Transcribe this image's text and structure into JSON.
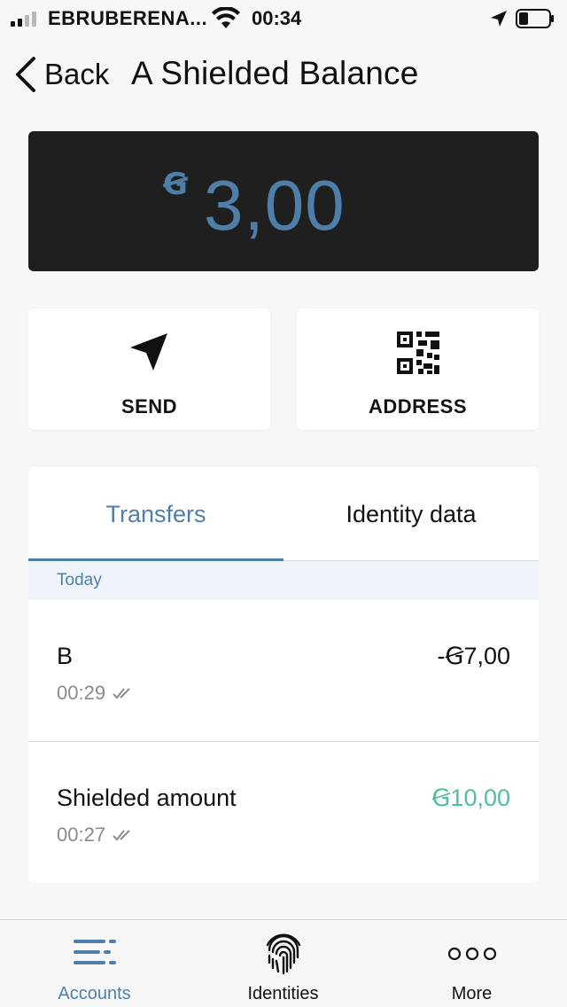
{
  "status_bar": {
    "carrier": "EBRUBERENA...",
    "time": "00:34"
  },
  "header": {
    "back_label": "Back",
    "title": "A Shielded Balance"
  },
  "balance": {
    "currency_symbol": "Ꞡ",
    "amount": "3,00"
  },
  "actions": {
    "send_label": "SEND",
    "address_label": "ADDRESS"
  },
  "tabs": {
    "transfers": "Transfers",
    "identity_data": "Identity data"
  },
  "section": {
    "today": "Today"
  },
  "transactions": [
    {
      "name": "B",
      "time": "00:29",
      "amount": "-Ꞡ7,00"
    },
    {
      "name": "Shielded amount",
      "time": "00:27",
      "amount": "Ꞡ10,00"
    }
  ],
  "bottom_nav": {
    "accounts": "Accounts",
    "identities": "Identities",
    "more": "More"
  },
  "colors": {
    "accent": "#4f7fa8",
    "positive": "#4fbf9f",
    "card_dark": "#1f1f1f"
  }
}
